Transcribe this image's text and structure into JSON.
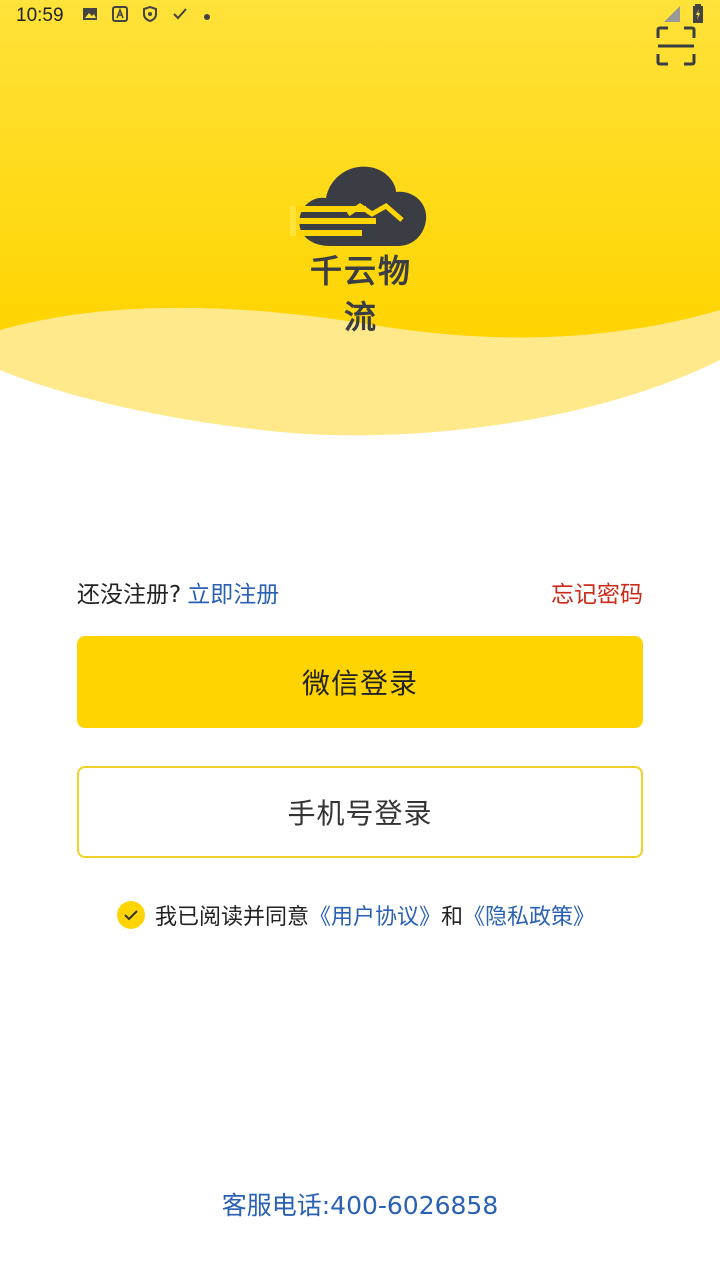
{
  "status_bar": {
    "time": "10:59",
    "icons": [
      "image-icon",
      "a-icon",
      "shield-icon",
      "check-icon",
      "dot-icon"
    ],
    "right_icons": [
      "signal-icon",
      "battery-icon"
    ]
  },
  "header": {
    "brand_name": "千云物流",
    "scan_icon": "scan-icon",
    "colors": {
      "primary": "#ffd400",
      "light": "#ffe98a"
    }
  },
  "register": {
    "prompt": "还没注册?",
    "link": "立即注册",
    "forgot": "忘记密码"
  },
  "buttons": {
    "wechat_login": "微信登录",
    "phone_login": "手机号登录"
  },
  "agreement": {
    "prefix": "我已阅读并同意",
    "user_agreement": "《用户协议》",
    "and": "和",
    "privacy_policy": "《隐私政策》",
    "checked": true
  },
  "footer": {
    "hotline": "客服电话:400-6026858"
  },
  "colors": {
    "link": "#2a61b3",
    "danger": "#cc2b1a",
    "accent": "#ffd400"
  }
}
